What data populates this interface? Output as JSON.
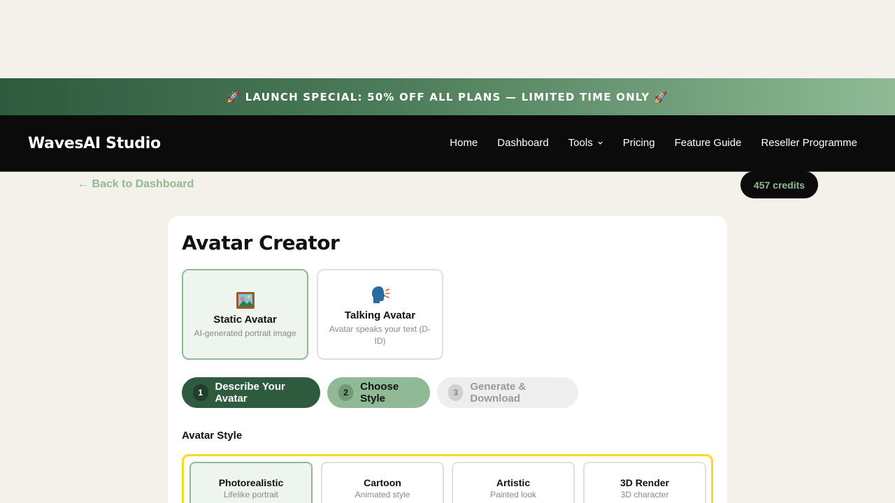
{
  "banner": {
    "text": "🚀 LAUNCH SPECIAL: 50% OFF ALL PLANS — LIMITED TIME ONLY 🚀"
  },
  "header": {
    "brand": "WavesAI Studio",
    "nav": [
      "Home",
      "Dashboard",
      "Tools",
      "Pricing",
      "Feature Guide",
      "Reseller Programme"
    ]
  },
  "top": {
    "back_label": "← Back to Dashboard",
    "credits": "457 credits"
  },
  "page": {
    "title": "Avatar Creator"
  },
  "modes": [
    {
      "icon": "framed-picture-icon",
      "name": "Static Avatar",
      "desc": "AI-generated portrait image",
      "active": true
    },
    {
      "icon": "speaking-head-icon",
      "name": "Talking Avatar",
      "desc": "Avatar speaks your text (D-ID)",
      "active": false
    }
  ],
  "steps": [
    {
      "num": "1",
      "label": "Describe Your Avatar",
      "state": "current"
    },
    {
      "num": "2",
      "label": "Choose Style",
      "state": "next"
    },
    {
      "num": "3",
      "label": "Generate & Download",
      "state": "disabled"
    }
  ],
  "style_section": {
    "label": "Avatar Style",
    "options": [
      {
        "name": "Photorealistic",
        "desc": "Lifelike portrait",
        "active": true
      },
      {
        "name": "Cartoon",
        "desc": "Animated style",
        "active": false
      },
      {
        "name": "Artistic",
        "desc": "Painted look",
        "active": false
      },
      {
        "name": "3D Render",
        "desc": "3D character",
        "active": false
      }
    ]
  },
  "colors": {
    "accent_dark": "#2e5a3e",
    "accent_light": "#8fba95",
    "highlight": "#f5dc1e",
    "background": "#f4f0ea"
  }
}
